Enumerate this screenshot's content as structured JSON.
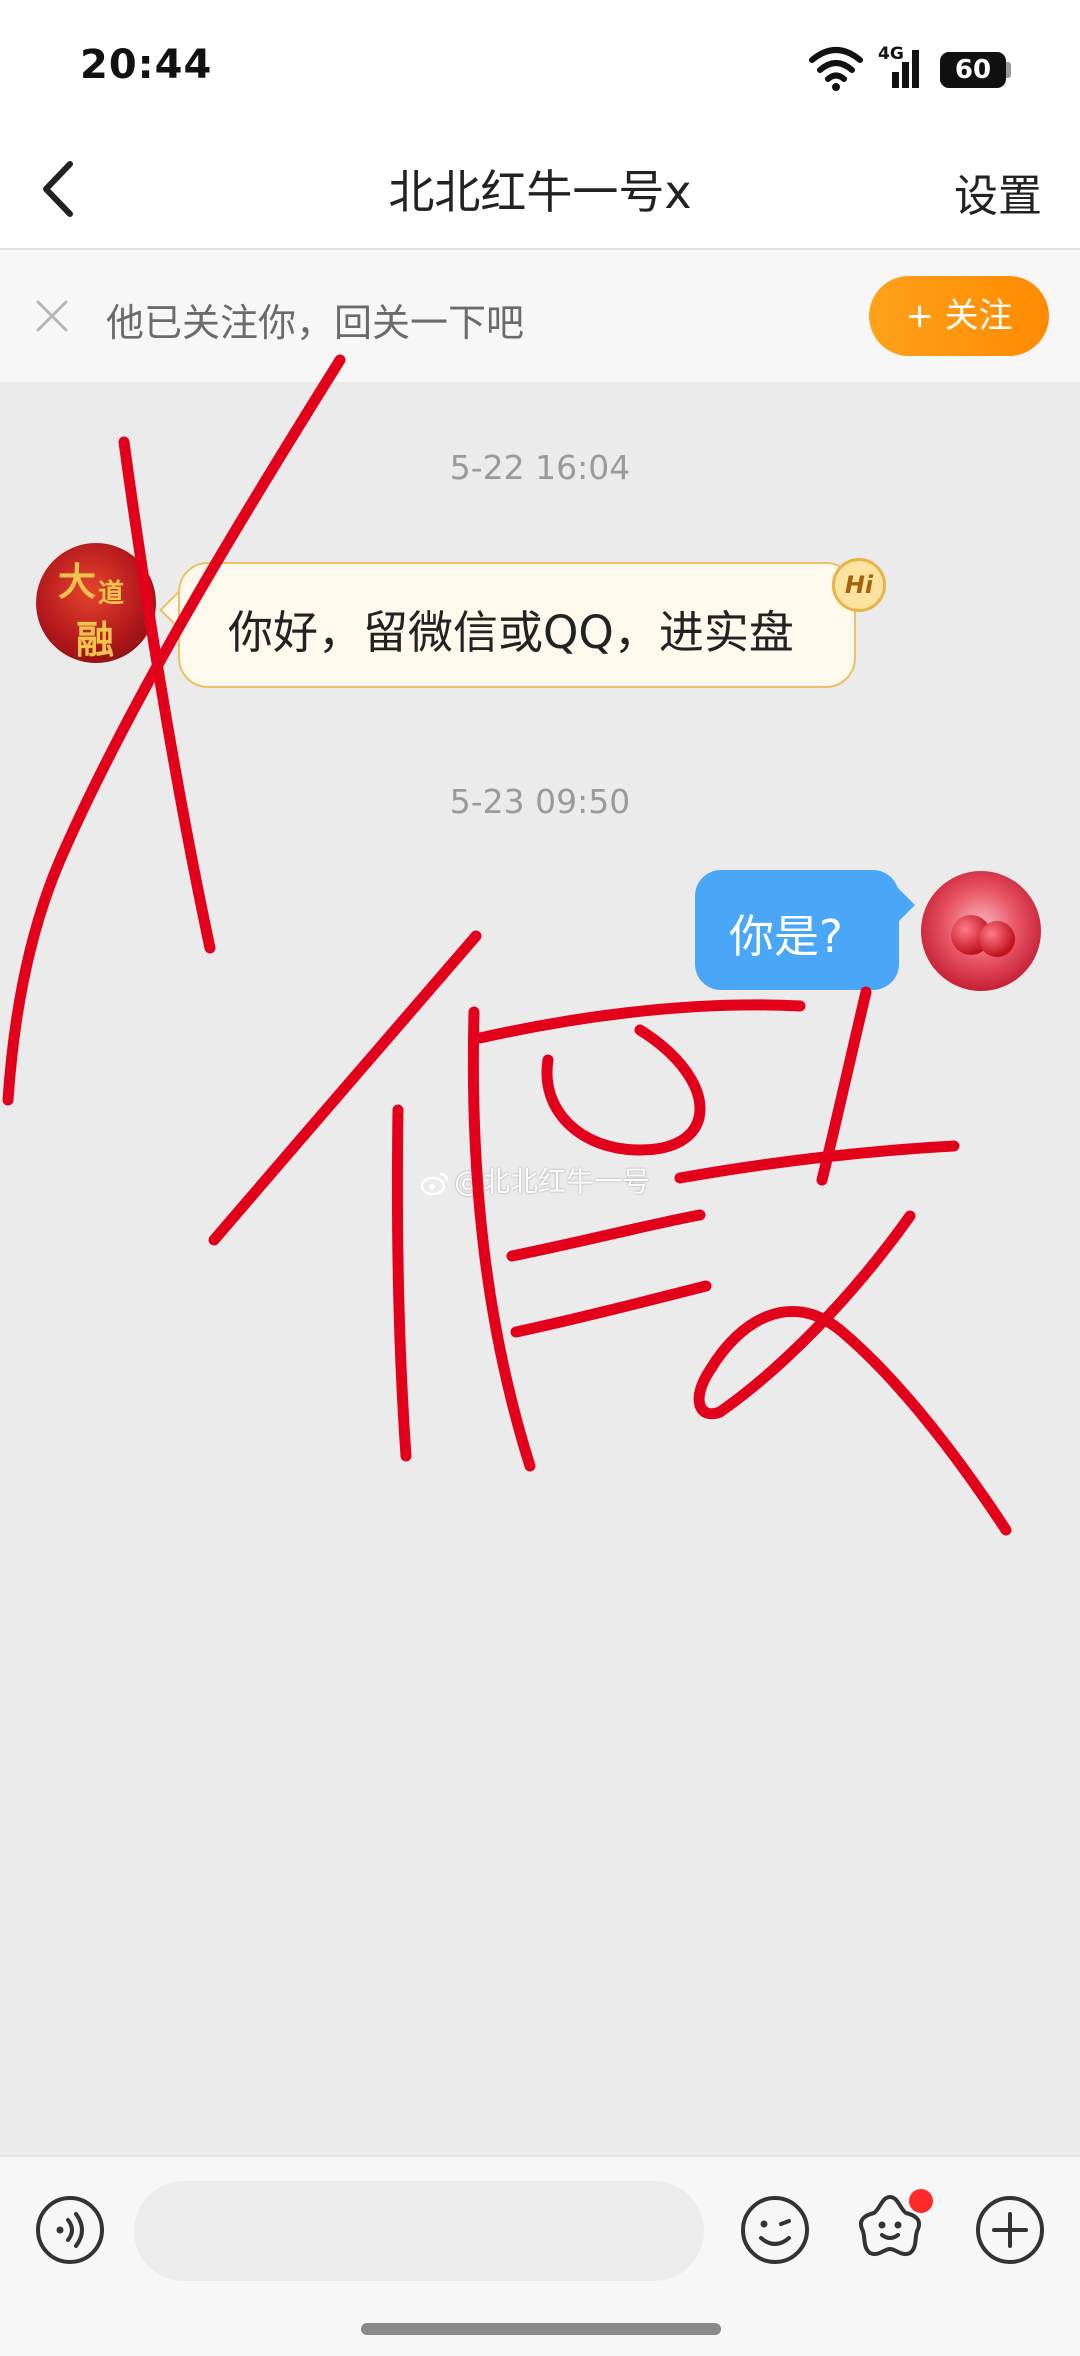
{
  "status_bar": {
    "time": "20:44",
    "network": "4G",
    "battery": "60"
  },
  "nav": {
    "title": "北北红牛一号x",
    "settings": "设置",
    "back_icon": "chevron-left-icon"
  },
  "follow_banner": {
    "text": "他已关注你，回关一下吧",
    "button": "+ 关注"
  },
  "messages": [
    {
      "timestamp": "5-22 16:04",
      "side": "left",
      "text": "你好，留微信或QQ，进实盘",
      "badge": "Hi"
    },
    {
      "timestamp": "5-23 09:50",
      "side": "right",
      "text": "你是?"
    }
  ],
  "avatar_left_glyphs": [
    "大",
    "道",
    "融"
  ],
  "watermark": "@北北红牛一号",
  "input_bar": {
    "placeholder": ""
  },
  "colors": {
    "follow": "#ff9500",
    "sent_bubble": "#4aa6f6",
    "received_bubble": "#fdf9ec",
    "annotation": "#e3001b"
  }
}
